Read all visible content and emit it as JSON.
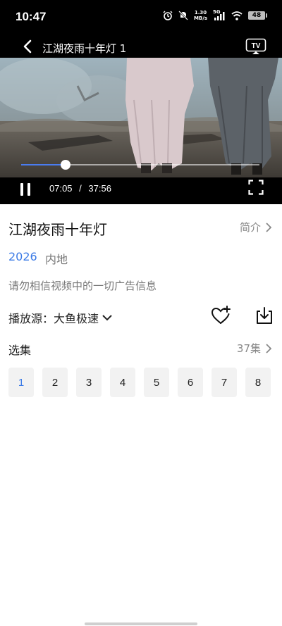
{
  "status": {
    "time": "10:47",
    "speed_top": "1.30",
    "speed_bottom": "MB/s",
    "network": "5G",
    "battery": "48"
  },
  "player": {
    "title": "江湖夜雨十年灯 1",
    "current_time": "07:05",
    "separator": "/",
    "total_time": "37:56",
    "progress": 0.187,
    "tv_label": "TV"
  },
  "show": {
    "title": "江湖夜雨十年灯",
    "intro_label": "简介",
    "year": "2026",
    "region": "内地",
    "notice": "请勿相信视频中的一切广告信息",
    "source_label": "播放源：大鱼极速",
    "episodes_label": "选集",
    "episodes_count": "37集",
    "episodes": [
      "1",
      "2",
      "3",
      "4",
      "5",
      "6",
      "7",
      "8"
    ],
    "active_episode": "1"
  },
  "colors": {
    "accent": "#3c7be6",
    "progress": "#4a7cf0"
  },
  "icons": [
    "back-arrow-icon",
    "tv-cast-icon",
    "pause-icon",
    "fullscreen-icon",
    "chevron-right-icon",
    "chevron-down-icon",
    "heart-plus-icon",
    "download-icon"
  ]
}
